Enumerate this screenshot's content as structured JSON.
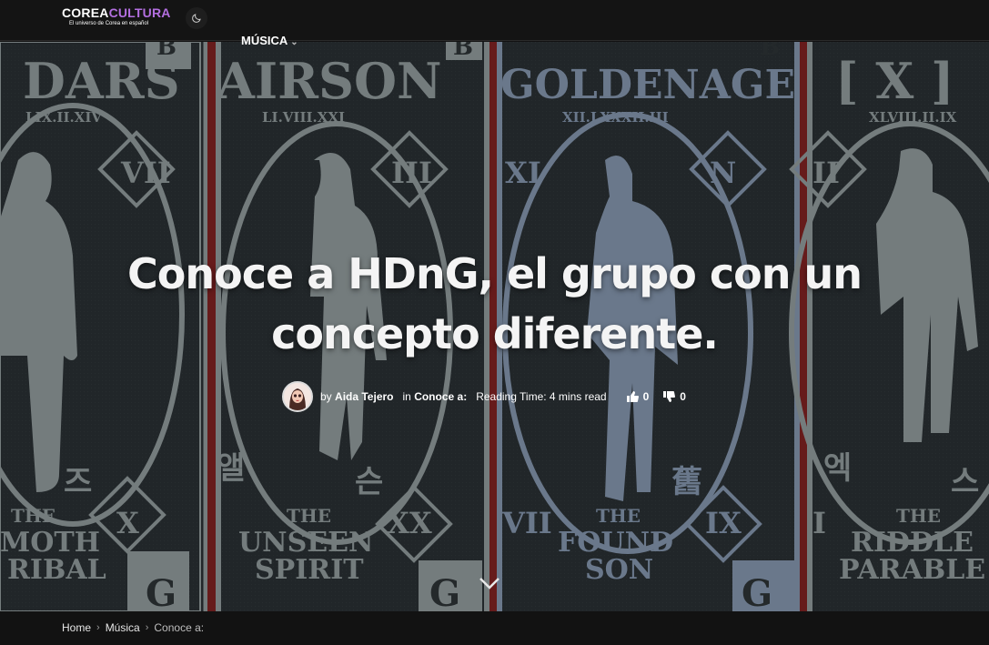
{
  "header": {
    "logo_part1": "COREA",
    "logo_part2": "CULTURA",
    "logo_tagline": "El universo de Corea en español",
    "theme_toggle_icon": "moon-icon",
    "nav_item": "MÚSICA",
    "nav_chevron_icon": "chevron-down-icon"
  },
  "hero": {
    "card_titles": [
      "DARS",
      "AIRSON",
      "GOLDENAGE",
      "[ X ]"
    ],
    "card_numerals": [
      "LIX.II.XIV",
      "LI.VIII.XXI",
      "XII.LXXXII.III",
      "XLVIII.II.IX"
    ],
    "card_badges": [
      "VII",
      "III",
      "XI",
      "N",
      "II"
    ],
    "card_bottom_badges": [
      "X",
      "XX",
      "VII",
      "IX",
      "I"
    ],
    "card_korean": [
      "즈",
      "앨",
      "슨",
      "舊",
      "엑",
      "스"
    ],
    "card_captions": [
      [
        "THE",
        "MOTH",
        "RIBAL"
      ],
      [
        "THE",
        "UNSEEN",
        "SPIRIT"
      ],
      [
        "THE",
        "FOUND",
        "SON"
      ],
      [
        "THE",
        "RIDDLE",
        "PARABLE"
      ]
    ],
    "card_letters": [
      "G",
      "G",
      "G",
      "B",
      "B",
      "B"
    ],
    "title_line1": "Conoce a HDnG, el grupo con un",
    "title_line2": "concepto diferente.",
    "meta": {
      "by": "by",
      "author": "Aida Tejero",
      "in": "in",
      "category": "Conoce a:",
      "reading_time": "Reading Time: 4 mins read",
      "likes": "0",
      "dislikes": "0"
    },
    "scroll_icon": "chevron-down-icon"
  },
  "breadcrumb": {
    "home": "Home",
    "section": "Música",
    "current": "Conoce a:"
  },
  "colors": {
    "header_bg": "#141414",
    "logo_accent": "#b36fe0",
    "red_stripe": "#7a1f1f",
    "card_gray": "#8b9597",
    "card_blue": "#7f90a8"
  }
}
